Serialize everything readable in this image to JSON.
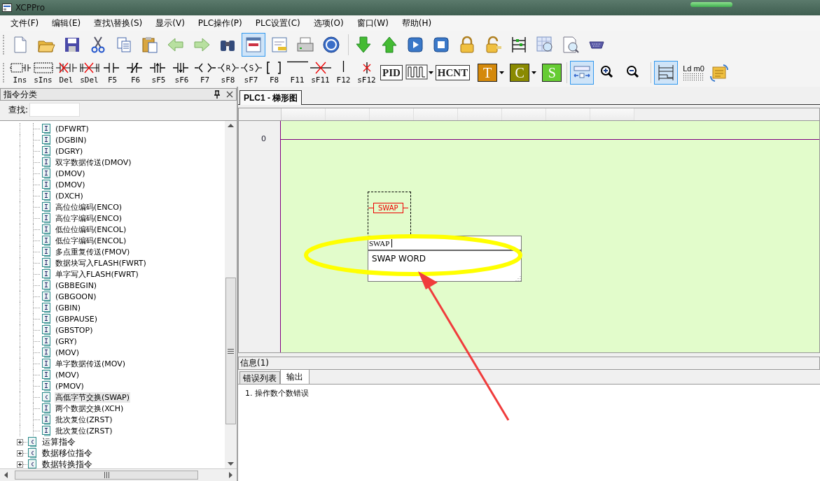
{
  "window": {
    "title": "XCPPro"
  },
  "menu": [
    "文件(F)",
    "编辑(E)",
    "查找\\替换(S)",
    "显示(V)",
    "PLC操作(P)",
    "PLC设置(C)",
    "选项(O)",
    "窗口(W)",
    "帮助(H)"
  ],
  "toolbar1": [
    {
      "kind": "new-file",
      "pressed": false
    },
    {
      "kind": "open-folder",
      "pressed": false
    },
    {
      "kind": "save",
      "pressed": false
    },
    {
      "kind": "cut",
      "pressed": false
    },
    {
      "kind": "copy",
      "pressed": false
    },
    {
      "kind": "paste",
      "pressed": false
    },
    {
      "kind": "back",
      "pressed": false
    },
    {
      "kind": "forward",
      "pressed": false
    },
    {
      "kind": "binoculars",
      "pressed": false
    },
    {
      "kind": "ladder-view",
      "pressed": true
    },
    {
      "kind": "list-view",
      "pressed": false
    },
    {
      "kind": "print",
      "pressed": false
    },
    {
      "kind": "help",
      "pressed": false
    },
    {
      "kind": "separator"
    },
    {
      "kind": "download",
      "pressed": false
    },
    {
      "kind": "upload",
      "pressed": false
    },
    {
      "kind": "run",
      "pressed": false
    },
    {
      "kind": "stop",
      "pressed": false
    },
    {
      "kind": "lock",
      "pressed": false
    },
    {
      "kind": "unlock",
      "pressed": false
    },
    {
      "kind": "ladder-monitor",
      "pressed": false
    },
    {
      "kind": "table-search",
      "pressed": false
    },
    {
      "kind": "doc-search",
      "pressed": false
    },
    {
      "kind": "serial-port",
      "pressed": false
    }
  ],
  "toolbar2": [
    {
      "kind": "insert-row",
      "label": "Ins"
    },
    {
      "kind": "insert-block",
      "label": "sIns"
    },
    {
      "kind": "delete-row",
      "label": "Del"
    },
    {
      "kind": "delete-block",
      "label": "sDel"
    },
    {
      "kind": "contact-open",
      "label": "F5"
    },
    {
      "kind": "contact-closed",
      "label": "F6"
    },
    {
      "kind": "contact-rise",
      "label": "sF5"
    },
    {
      "kind": "contact-fall",
      "label": "sF6"
    },
    {
      "kind": "coil",
      "label": "F7"
    },
    {
      "kind": "coil-mark",
      "label": "sF8",
      "mark": "R"
    },
    {
      "kind": "coil-mark",
      "label": "sF7",
      "mark": "S"
    },
    {
      "kind": "brackets",
      "label": "F8"
    },
    {
      "kind": "hline",
      "label": "F11"
    },
    {
      "kind": "hline-delete",
      "label": "sF11"
    },
    {
      "kind": "vline",
      "label": "F12"
    },
    {
      "kind": "vline-delete",
      "label": "sF12"
    },
    {
      "kind": "text-box",
      "text": "PID"
    },
    {
      "kind": "pulse",
      "dropdown": true
    },
    {
      "kind": "text-box",
      "text": "HCNT"
    },
    {
      "kind": "color-box",
      "text": "T",
      "color": "#d4890b",
      "dropdown": true
    },
    {
      "kind": "color-box",
      "text": "C",
      "color": "#8a8a00",
      "dropdown": true
    },
    {
      "kind": "color-box",
      "text": "S",
      "color": "#66cc33"
    },
    {
      "kind": "separator"
    },
    {
      "kind": "dock-toggle",
      "pressed": true
    },
    {
      "kind": "zoom-in",
      "pressed": false
    },
    {
      "kind": "zoom-out",
      "pressed": false
    },
    {
      "kind": "separator"
    },
    {
      "kind": "ladder-toggle",
      "pressed": true
    },
    {
      "kind": "list-text",
      "text": "Ld m0"
    },
    {
      "kind": "convert",
      "pressed": false
    }
  ],
  "sidebar": {
    "title": "指令分类",
    "search": {
      "label": "查找:"
    },
    "tree": [
      {
        "children": [
          {
            "label": "(DFWRT)",
            "kind": "instruction",
            "selected": false
          },
          {
            "label": "(DGBIN)",
            "kind": "instruction",
            "selected": false
          },
          {
            "label": "(DGRY)",
            "kind": "instruction",
            "selected": false
          },
          {
            "label": "双字数据传送(DMOV)",
            "kind": "instruction",
            "selected": false
          },
          {
            "label": "(DMOV)",
            "kind": "instruction",
            "selected": false
          },
          {
            "label": "(DMOV)",
            "kind": "instruction",
            "selected": false
          },
          {
            "label": "(DXCH)",
            "kind": "instruction",
            "selected": false
          },
          {
            "label": "高位位编码(ENCO)",
            "kind": "instruction",
            "selected": false
          },
          {
            "label": "高位字编码(ENCO)",
            "kind": "instruction",
            "selected": false
          },
          {
            "label": "低位位编码(ENCOL)",
            "kind": "instruction",
            "selected": false
          },
          {
            "label": "低位字编码(ENCOL)",
            "kind": "instruction",
            "selected": false
          },
          {
            "label": "多点重复传送(FMOV)",
            "kind": "instruction",
            "selected": false
          },
          {
            "label": "数据块写入FLASH(FWRT)",
            "kind": "instruction",
            "selected": false
          },
          {
            "label": "单字写入FLASH(FWRT)",
            "kind": "instruction",
            "selected": false
          },
          {
            "label": "(GBBEGIN)",
            "kind": "instruction",
            "selected": false
          },
          {
            "label": "(GBGOON)",
            "kind": "instruction",
            "selected": false
          },
          {
            "label": "(GBIN)",
            "kind": "instruction",
            "selected": false
          },
          {
            "label": "(GBPAUSE)",
            "kind": "instruction",
            "selected": false
          },
          {
            "label": "(GBSTOP)",
            "kind": "instruction",
            "selected": false
          },
          {
            "label": "(GRY)",
            "kind": "instruction",
            "selected": false
          },
          {
            "label": "(MOV)",
            "kind": "instruction",
            "selected": false
          },
          {
            "label": "单字数据传送(MOV)",
            "kind": "instruction",
            "selected": false
          },
          {
            "label": "(MOV)",
            "kind": "instruction",
            "selected": false
          },
          {
            "label": "(PMOV)",
            "kind": "instruction",
            "selected": false
          },
          {
            "label": "高低字节交换(SWAP)",
            "kind": "category",
            "selected": true
          },
          {
            "label": "两个数据交换(XCH)",
            "kind": "instruction",
            "selected": false
          },
          {
            "label": "批次复位(ZRST)",
            "kind": "instruction",
            "selected": false
          },
          {
            "label": "批次复位(ZRST)",
            "kind": "instruction",
            "selected": false
          }
        ]
      },
      {
        "label": "运算指令",
        "kind": "category",
        "expanded": false,
        "selected": false
      },
      {
        "label": "数据移位指令",
        "kind": "category",
        "expanded": false,
        "selected": false
      },
      {
        "label": "数据转换指令",
        "kind": "category",
        "expanded": false,
        "selected": false
      }
    ]
  },
  "document_tabs": [
    {
      "label": "PLC1 - 梯形图",
      "selected": true
    }
  ],
  "ladder": {
    "rows": [
      {
        "number": "0"
      }
    ],
    "element": {
      "text": "SWAP"
    },
    "autocomplete": {
      "value": "SWAP ",
      "suggestions": [
        "SWAP WORD"
      ]
    }
  },
  "info_panel": {
    "title": "信息(1)",
    "tabs": [
      {
        "label": "错误列表",
        "selected": false
      },
      {
        "label": "输出",
        "selected": true
      }
    ],
    "lines": [
      "1. 操作数个数错误"
    ]
  },
  "annotations": [
    {
      "kind": "ellipse"
    },
    {
      "kind": "arrow"
    }
  ]
}
